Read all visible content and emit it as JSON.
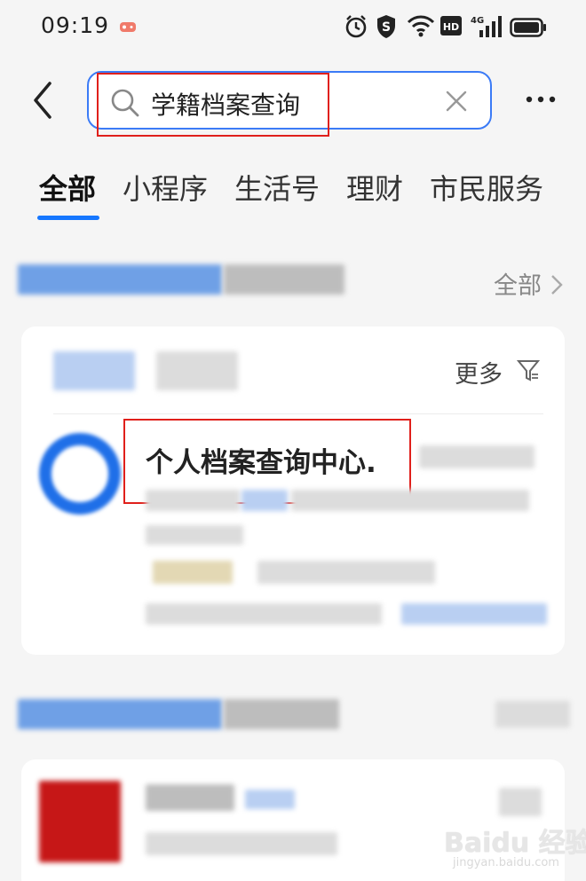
{
  "status_bar": {
    "time": "09:19",
    "icons": [
      "game-icon",
      "alarm-icon",
      "shield-s-icon",
      "wifi-icon",
      "hd-icon",
      "4g-signal-icon",
      "battery-icon"
    ],
    "hd_label": "HD",
    "network_label": "4G"
  },
  "header": {
    "search_value": "学籍档案查询",
    "back_icon": "chevron-left-icon",
    "clear_icon": "close-icon",
    "more_icon": "more-dots-icon"
  },
  "tabs": [
    {
      "label": "全部",
      "active": true
    },
    {
      "label": "小程序",
      "active": false
    },
    {
      "label": "生活号",
      "active": false
    },
    {
      "label": "理财",
      "active": false
    },
    {
      "label": "市民服务",
      "active": false
    }
  ],
  "section1": {
    "all_label": "全部"
  },
  "card1": {
    "more_label": "更多",
    "result_title": "个人档案查询中心."
  },
  "watermark": {
    "logo": "Baidu 经验",
    "url": "jingyan.baidu.com"
  },
  "colors": {
    "accent": "#1677ff",
    "search_border": "#3b7bf6",
    "highlight_box": "#e0201b",
    "background": "#f5f5f5"
  }
}
